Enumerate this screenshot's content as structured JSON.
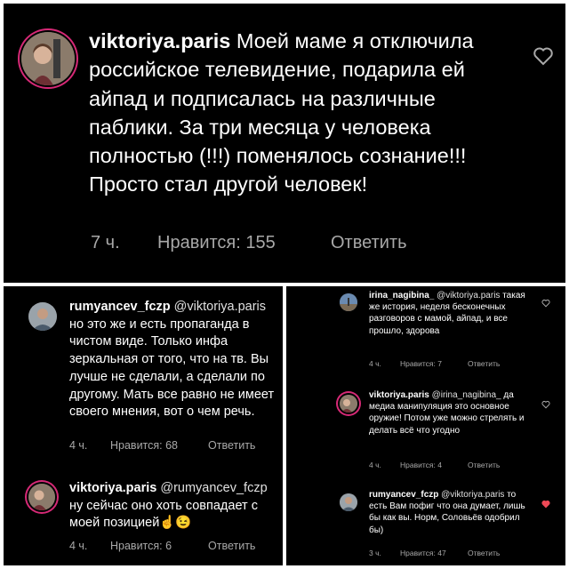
{
  "main_comment": {
    "username": "viktoriya.paris",
    "text": "Моей маме я отключила российское телевидение, подарила ей айпад и подписалась на различные паблики. За три месяца у человека полностью (!!!) поменялось сознание!!! Просто стал другой человек!",
    "time": "7 ч.",
    "likes": "Нравится: 155",
    "reply": "Ответить",
    "icon": "heart-outline-icon"
  },
  "left_thread": [
    {
      "username": "rumyancev_fczp",
      "mention": "@viktoriya.paris",
      "text": "но это же и есть пропаганда в чистом виде. Только инфа зеркальная от того, что на тв. Вы лучше не сделали, а сделали по другому. Мать все равно не имеет своего мнения, вот о чем речь.",
      "time": "4 ч.",
      "likes": "Нравится: 68",
      "reply": "Ответить"
    },
    {
      "username": "viktoriya.paris",
      "mention": "@rumyancev_fczp",
      "text": "ну сейчас оно хоть совпадает с моей позицией☝😉",
      "time": "4 ч.",
      "likes": "Нравится: 6",
      "reply": "Ответить"
    }
  ],
  "right_thread": [
    {
      "username": "irina_nagibina_",
      "mention": "@viktoriya.paris",
      "text": "такая же история, неделя бесконечных разговоров с мамой, айпад, и все прошло, здорова",
      "time": "4 ч.",
      "likes": "Нравится: 7",
      "reply": "Ответить",
      "liked": false
    },
    {
      "username": "viktoriya.paris",
      "mention": "@irina_nagibina_",
      "text": "да медиа манипуляция это основное оружие! Потом уже можно стрелять и делать всё что угодно",
      "time": "4 ч.",
      "likes": "Нравится: 4",
      "reply": "Ответить",
      "liked": false
    },
    {
      "username": "rumyancev_fczp",
      "mention": "@viktoriya.paris",
      "text": "то есть Вам пофиг что она думает, лишь бы как вы. Норм, Соловьёв одобрил бы)",
      "time": "3 ч.",
      "likes": "Нравится: 47",
      "reply": "Ответить",
      "liked": true
    }
  ],
  "colors": {
    "background": "#000000",
    "text": "#ffffff",
    "meta": "#a8a8a8",
    "heart_liked": "#ed4956",
    "story_ring": "#d62976"
  }
}
